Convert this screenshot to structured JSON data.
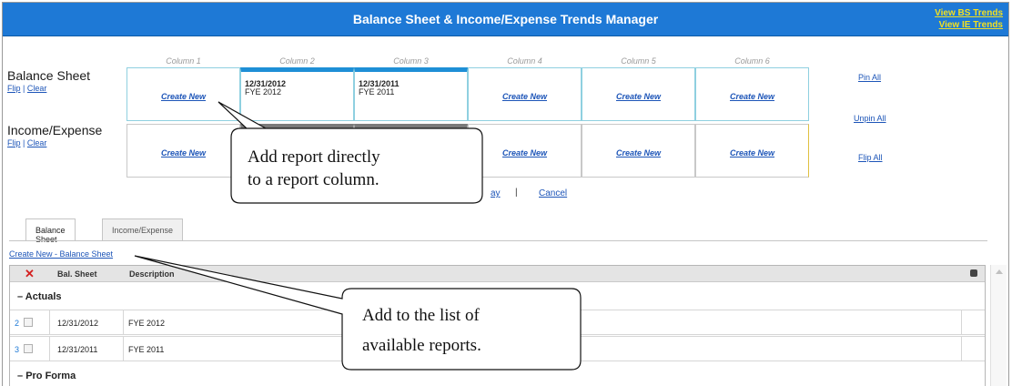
{
  "app": {
    "title": "Balance Sheet & Income/Expense Trends Manager",
    "header_links": [
      "View BS Trends",
      "View IE Trends"
    ]
  },
  "rows": {
    "balance_sheet": {
      "label": "Balance Sheet",
      "flip": "Flip",
      "clear": "Clear",
      "sep": "|"
    },
    "income_expense": {
      "label": "Income/Expense",
      "flip": "Flip",
      "clear": "Clear",
      "sep": "|"
    }
  },
  "columns": [
    "Column 1",
    "Column 2",
    "Column 3",
    "Column 4",
    "Column 5",
    "Column 6"
  ],
  "create_new_label": "Create New",
  "balance_cells": [
    {
      "type": "create"
    },
    {
      "type": "report",
      "date": "12/31/2012",
      "name": "FYE 2012"
    },
    {
      "type": "report",
      "date": "12/31/2011",
      "name": "FYE 2011"
    },
    {
      "type": "create"
    },
    {
      "type": "create"
    },
    {
      "type": "create"
    }
  ],
  "side_actions": {
    "pin_all": "Pin All",
    "unpin_all": "Unpin All",
    "flip_all": "Flip All"
  },
  "actions": {
    "partial": "ay",
    "sep": "|",
    "cancel": "Cancel"
  },
  "tabs": [
    {
      "label": "Balance Sheet",
      "active": true
    },
    {
      "label": "Income/Expense",
      "active": false
    }
  ],
  "create_list_link": "Create New - Balance Sheet",
  "table": {
    "headers": [
      "Bal. Sheet",
      "Description"
    ],
    "groups": [
      {
        "label": "Actuals",
        "toggle": "–"
      },
      {
        "label": "Pro Forma",
        "toggle": "–"
      }
    ],
    "rows": [
      {
        "num": "2",
        "date": "12/31/2012",
        "desc": "FYE 2012"
      },
      {
        "num": "3",
        "date": "12/31/2011",
        "desc": "FYE 2011"
      }
    ]
  },
  "callouts": {
    "top": [
      "Add report directly",
      "to a report column."
    ],
    "bottom": [
      "Add to the list of",
      "available reports."
    ]
  }
}
